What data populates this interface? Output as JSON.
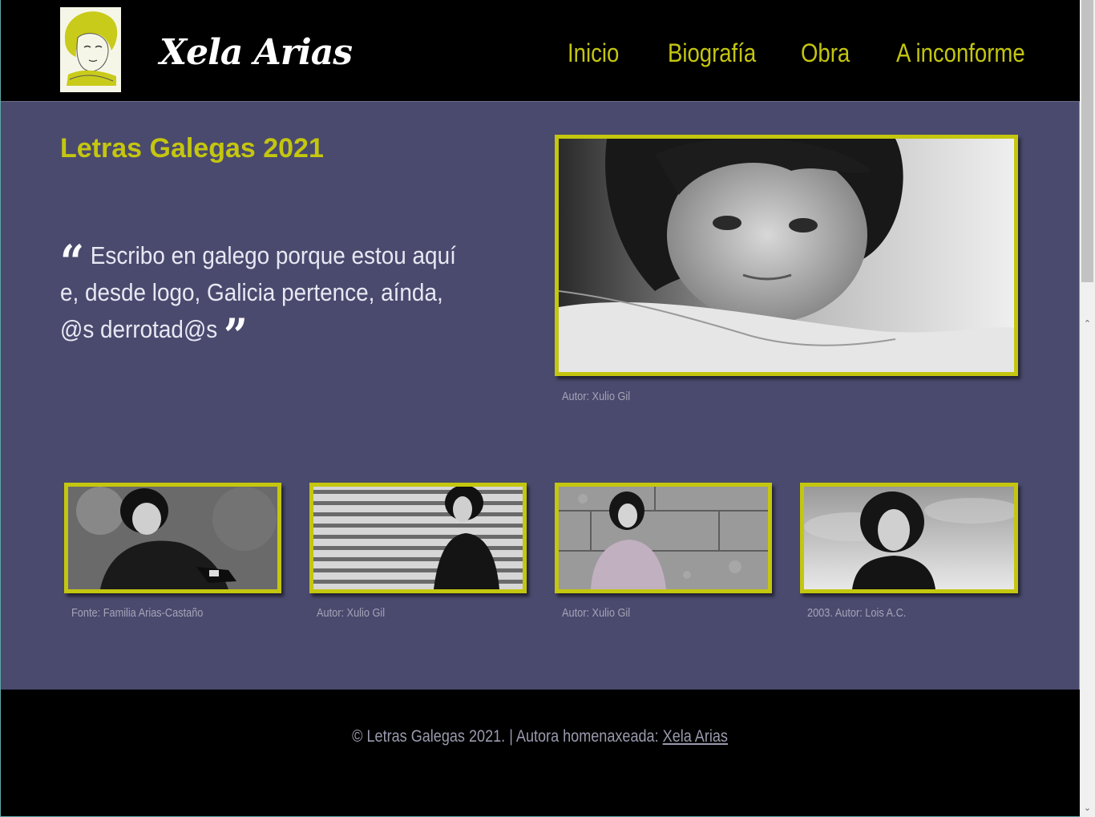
{
  "header": {
    "logo_alt": "Xela Arias",
    "site_title": "Xela Arias",
    "nav": [
      {
        "label": "Inicio"
      },
      {
        "label": "Biografía"
      },
      {
        "label": "Obra"
      },
      {
        "label": "A inconforme"
      }
    ]
  },
  "main": {
    "heading": "Letras Galegas 2021",
    "quote": "Escribo en galego porque estou aquí e, desde logo, Galicia pertence, aínda, @s derrotad@s",
    "hero_photo": {
      "caption": "Autor: Xulio Gil"
    },
    "gallery": [
      {
        "caption": "Fonte: Familia Arias-Castaño"
      },
      {
        "caption": "Autor: Xulio Gil"
      },
      {
        "caption": "Autor: Xulio Gil"
      },
      {
        "caption": "2003. Autor: Lois A.C."
      }
    ]
  },
  "footer": {
    "text": "© Letras Galegas 2021. | Autora homenaxeada: ",
    "link": "Xela Arias"
  },
  "colors": {
    "accent": "#c4c60f",
    "background": "#4a4a6e",
    "header_bg": "#000000"
  }
}
